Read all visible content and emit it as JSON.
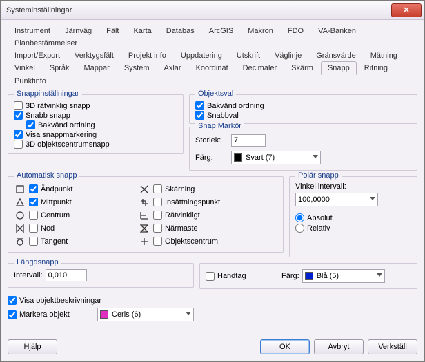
{
  "window": {
    "title": "Systeminställningar"
  },
  "tabs": {
    "row1": [
      "Instrument",
      "Järnväg",
      "Fält",
      "Karta",
      "Databas",
      "ArcGIS",
      "Makron",
      "FDO",
      "VA-Banken",
      "Planbestämmelser"
    ],
    "row2": [
      "Import/Export",
      "Verktygsfält",
      "Projekt info",
      "Uppdatering",
      "Utskrift",
      "Väglinje",
      "Gränsvärde",
      "Mätning"
    ],
    "row3": [
      "Vinkel",
      "Språk",
      "Mappar",
      "System",
      "Axlar",
      "Koordinat",
      "Decimaler",
      "Skärm",
      "Snapp",
      "Ritning",
      "Punktinfo"
    ],
    "selected": "Snapp"
  },
  "snappinst": {
    "legend": "Snappinställningar",
    "items": {
      "rect3d": {
        "label": "3D rätvinklig snapp",
        "checked": false
      },
      "snabb": {
        "label": "Snabb snapp",
        "checked": true
      },
      "bakv": {
        "label": "Bakvänd ordning",
        "checked": true
      },
      "visa": {
        "label": "Visa snappmarkering",
        "checked": true
      },
      "obj3d": {
        "label": "3D objektscentrumsnapp",
        "checked": false
      }
    }
  },
  "objektsval": {
    "legend": "Objektsval",
    "items": {
      "bakv": {
        "label": "Bakvänd ordning",
        "checked": true
      },
      "snabb": {
        "label": "Snabbval",
        "checked": true
      }
    }
  },
  "snapmarkor": {
    "legend": "Snap Markör",
    "size_label": "Storlek:",
    "size_value": "7",
    "color_label": "Färg:",
    "color_value": "Svart (7)",
    "color_hex": "#000000"
  },
  "autosnapp": {
    "legend": "Automatisk snapp",
    "left": [
      {
        "icon": "square",
        "label": "Ändpunkt",
        "checked": true
      },
      {
        "icon": "triangle",
        "label": "Mittpunkt",
        "checked": true
      },
      {
        "icon": "circle",
        "label": "Centrum",
        "checked": false
      },
      {
        "icon": "bowtie",
        "label": "Nod",
        "checked": false
      },
      {
        "icon": "tangent",
        "label": "Tangent",
        "checked": false
      }
    ],
    "right": [
      {
        "icon": "cross",
        "label": "Skärning",
        "checked": false
      },
      {
        "icon": "insert",
        "label": "Insättningspunkt",
        "checked": false
      },
      {
        "icon": "perp",
        "label": "Rätvinkligt",
        "checked": false
      },
      {
        "icon": "hour",
        "label": "Närmaste",
        "checked": false
      },
      {
        "icon": "plus",
        "label": "Objektscentrum",
        "checked": false
      }
    ]
  },
  "polar": {
    "legend": "Polär snapp",
    "angle_label": "Vinkel intervall:",
    "angle_value": "100,0000",
    "absolut": "Absolut",
    "relativ": "Relativ",
    "selected": "Absolut"
  },
  "langd": {
    "legend": "Längdsnapp",
    "label": "Intervall:",
    "value": "0,010"
  },
  "handtag": {
    "label": "Handtag",
    "checked": false,
    "color_label": "Färg:",
    "color_value": "Blå (5)",
    "color_hex": "#0020d0"
  },
  "bottom": {
    "visa_obj": {
      "label": "Visa objektbeskrivningar",
      "checked": true
    },
    "markera": {
      "label": "Markera objekt",
      "checked": true
    },
    "mark_color_value": "Ceris (6)",
    "mark_color_hex": "#e030c0"
  },
  "buttons": {
    "help": "Hjälp",
    "ok": "OK",
    "cancel": "Avbryt",
    "apply": "Verkställ"
  }
}
